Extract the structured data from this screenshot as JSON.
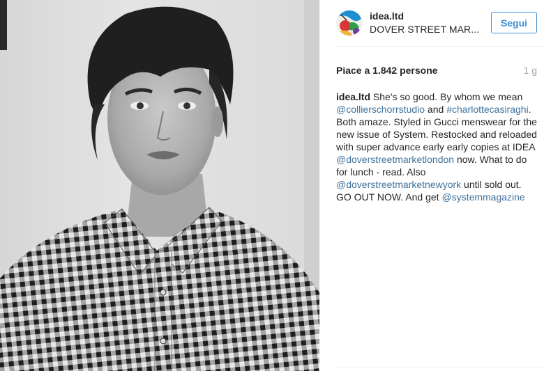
{
  "post": {
    "username": "idea.ltd",
    "location": "DOVER STREET MAR...",
    "follow_label": "Segui",
    "likes": "Piace a 1.842 persone",
    "timestamp": "1 g",
    "caption": [
      {
        "type": "user",
        "text": "idea.ltd"
      },
      {
        "type": "text",
        "text": " She's so good. By whom we mean "
      },
      {
        "type": "link",
        "text": "@collierschorrstudio"
      },
      {
        "type": "text",
        "text": " and "
      },
      {
        "type": "link",
        "text": "#charlottecasiraghi"
      },
      {
        "type": "text",
        "text": ". Both amaze. Styled in Gucci menswear for the new issue of System. Restocked and reloaded with super advance early early copies at IDEA "
      },
      {
        "type": "link",
        "text": "@doverstreetmarketlondon"
      },
      {
        "type": "text",
        "text": " now. What to do for lunch - read. Also "
      },
      {
        "type": "link",
        "text": "@doverstreetmarketnewyork"
      },
      {
        "type": "text",
        "text": " until sold out. GO OUT NOW. And get "
      },
      {
        "type": "link",
        "text": "@systemmagazine"
      }
    ]
  },
  "icons": {
    "avatar": "profile-avatar-image",
    "photo": "portrait-photo"
  },
  "colors": {
    "link": "#3f729b",
    "follow": "#3f8fd6",
    "muted": "#a5a5a5"
  }
}
